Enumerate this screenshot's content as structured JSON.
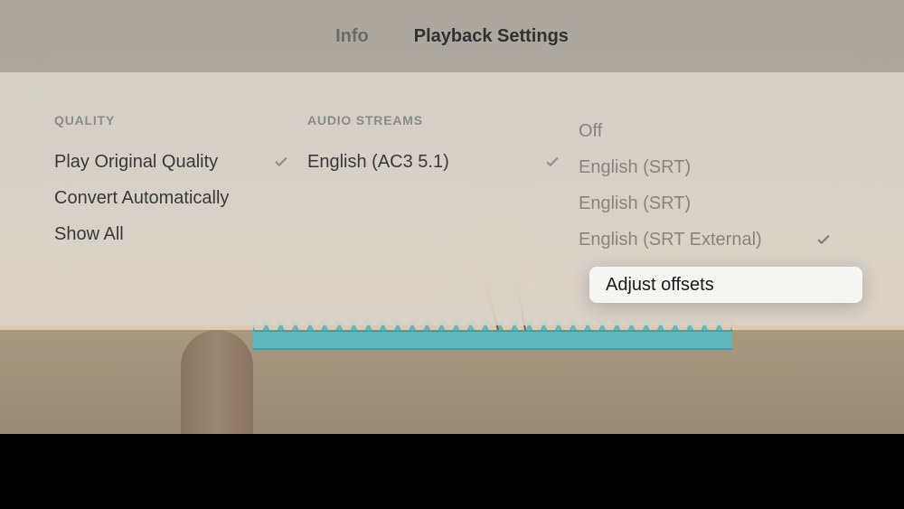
{
  "header": {
    "tabs": [
      {
        "label": "Info",
        "active": false
      },
      {
        "label": "Playback Settings",
        "active": true
      }
    ]
  },
  "quality": {
    "header": "QUALITY",
    "options": [
      {
        "label": "Play Original Quality",
        "selected": true
      },
      {
        "label": "Convert Automatically",
        "selected": false
      },
      {
        "label": "Show All",
        "selected": false
      }
    ]
  },
  "audio": {
    "header": "AUDIO STREAMS",
    "options": [
      {
        "label": "English (AC3 5.1)",
        "selected": true
      }
    ]
  },
  "subtitles": {
    "options": [
      {
        "label": "Off",
        "selected": false
      },
      {
        "label": "English (SRT)",
        "selected": false
      },
      {
        "label": "English (SRT)",
        "selected": false
      },
      {
        "label": "English (SRT External)",
        "selected": true
      }
    ],
    "highlighted": "Adjust offsets"
  }
}
